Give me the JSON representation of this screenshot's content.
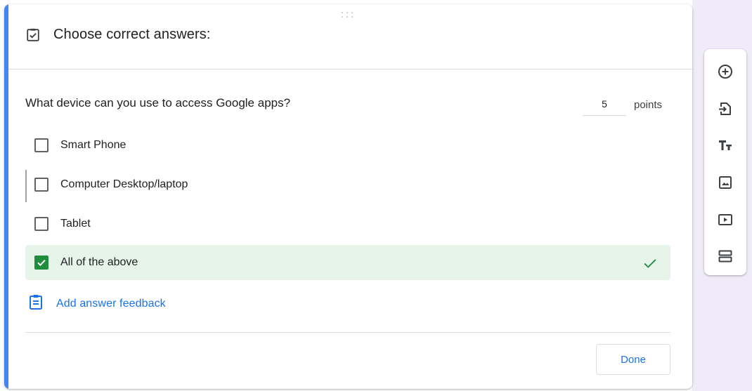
{
  "question": {
    "header_title": "Choose correct answers:",
    "text": "What device can you use to access Google apps?",
    "points_value": "5",
    "points_label": "points",
    "options": [
      {
        "label": "Smart Phone",
        "checked": false
      },
      {
        "label": "Computer Desktop/laptop",
        "checked": false
      },
      {
        "label": "Tablet",
        "checked": false
      },
      {
        "label": "All of the above",
        "checked": true
      }
    ],
    "feedback_label": "Add answer feedback",
    "done_label": "Done"
  },
  "colors": {
    "accent": "#4285f4",
    "link": "#1a73e8",
    "correct": "#1e8e3e",
    "selected_bg": "#e6f4ea",
    "lavender_bg": "#f0ebf8"
  },
  "icons": {
    "header": "checkbox-checked-outline-icon",
    "feedback": "clipboard-feedback-icon",
    "toolbar": [
      "add-circle-icon",
      "import-question-icon",
      "title-text-icon",
      "image-icon",
      "video-icon",
      "section-icon"
    ]
  }
}
